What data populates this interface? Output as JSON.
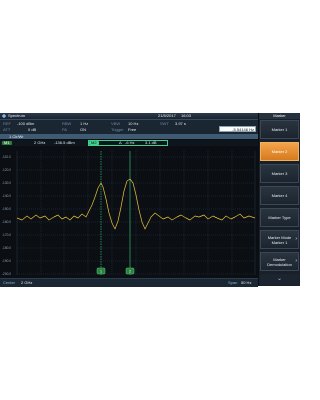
{
  "header": {
    "app_title": "Spectrum",
    "date": "21/5/2017",
    "time": "16:03",
    "panel_title": "Marker"
  },
  "params": {
    "ref_label": "REF",
    "ref_value": "-100 dBm",
    "att_label": "ATT",
    "att_value": "0 dB",
    "rbw_label": "RBW",
    "rbw_value": "1 Hz",
    "pa_label": "PA",
    "pa_value": "ON",
    "vbw_label": "VBW",
    "vbw_value": "10 Hz",
    "trigger_label": "Trigger",
    "trigger_value": "Free",
    "swt_label": "SWT",
    "swt_value": "3.97 s",
    "marker_input": "-5.54146 Hz"
  },
  "trace": {
    "label": "1 Clr/Wr"
  },
  "markers": {
    "m1_badge": "M1",
    "m1_freq": "2 GHz",
    "m1_level": "-136.5 dBm",
    "m2_badge": "M2",
    "m2_delta": "Δ",
    "m2_freq": "-6 Hz",
    "m2_level": "3.1 dB"
  },
  "y_ticks": [
    "-110.0",
    "-120.0",
    "-130.0",
    "-140.0",
    "-150.0",
    "-160.0",
    "-170.0",
    "-180.0",
    "-190.0",
    "-200.0"
  ],
  "plot_markers": [
    "1",
    "2"
  ],
  "footer": {
    "center_label": "Center",
    "center_value": "2 GHz",
    "span_label": "Span",
    "span_value": "50 Hz"
  },
  "softkeys": [
    {
      "line1": "Marker 1",
      "line2": "",
      "active": false,
      "arrow": false
    },
    {
      "line1": "Marker 2",
      "line2": "",
      "active": true,
      "arrow": false
    },
    {
      "line1": "Marker 3",
      "line2": "",
      "active": false,
      "arrow": false
    },
    {
      "line1": "Marker 4",
      "line2": "",
      "active": false,
      "arrow": false
    },
    {
      "line1": "Marker Type",
      "line2": "",
      "active": false,
      "arrow": false
    },
    {
      "line1": "Marker Mode",
      "line2": "Marker 1",
      "active": false,
      "arrow": true
    },
    {
      "line1": "Marker",
      "line2": "Demodulation",
      "active": false,
      "arrow": true
    }
  ],
  "colors": {
    "trace": "#e8c23a",
    "marker_line": "#3fd08a",
    "accent": "#f29a3c"
  },
  "icons": {
    "logo": "rs-logo-icon",
    "scroll": "chevron-down-icon"
  }
}
